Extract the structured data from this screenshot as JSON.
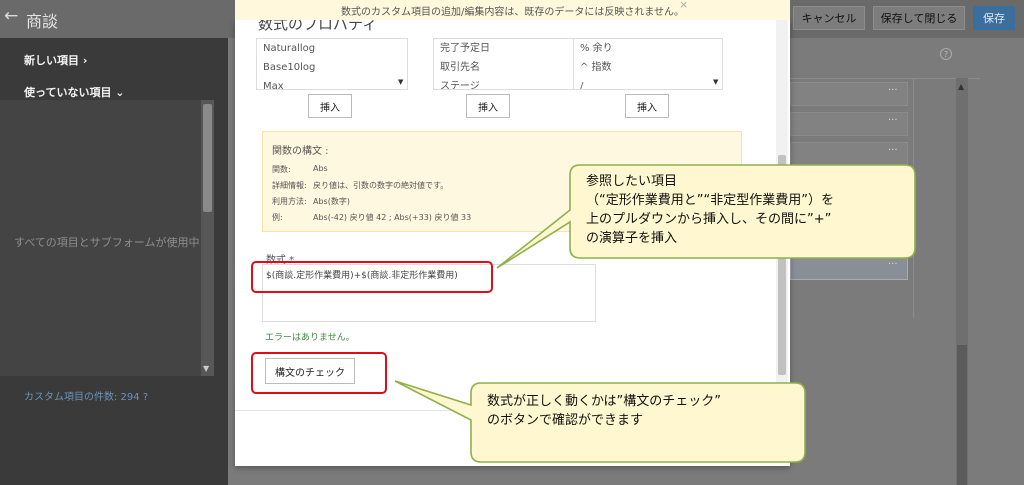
{
  "topbar": {
    "back_glyph": "←",
    "title": "商談",
    "cancel_label": "キャンセル",
    "save_close_label": "保存して閉じる",
    "save_label": "保存"
  },
  "sidebar": {
    "new_items": "新しい項目 ›",
    "unused_items": "使っていない項目 ⌄",
    "all_used": "すべての項目とサブフォームが使用中",
    "custom_count": "カスタム項目の件数: 294 ?"
  },
  "notice": {
    "text": "数式のカスタム項目の追加/編集内容は、既存のデータには反映されません。",
    "close": "×"
  },
  "modal": {
    "title": "数式のプロパティ",
    "functions_list": [
      "Naturallog",
      "Base10log",
      "Max"
    ],
    "fields_list": [
      "完了予定日",
      "取引先名",
      "ステージ"
    ],
    "operators_list": [
      "% 余り",
      "^ 指数",
      "/"
    ],
    "insert_label": "挿入",
    "syntax": {
      "title": "関数の構文 :",
      "rows": [
        {
          "key": "関数:",
          "value": "Abs"
        },
        {
          "key": "詳細情報:",
          "value": "戻り値は、引数の数字の絶対値です。"
        },
        {
          "key": "利用方法:",
          "value": "Abs(数字)"
        },
        {
          "key": "例:",
          "value": "Abs(-42) 戻り値 42 ; Abs(+33) 戻り値 33"
        }
      ]
    },
    "formula_label": "数式 *",
    "formula_value": "$(商談.定形作業費用)+$(商談.非定形作業費用)",
    "no_error": "エラーはありません。",
    "check_syntax_label": "構文のチェック"
  },
  "callouts": {
    "c1": [
      "参照したい項目",
      "（“定形作業費用と”“非定型作業費用”）を",
      "上のプルダウンから挿入し、その間に”+”",
      "の演算子を挿入"
    ],
    "c2": [
      "数式が正しく動くかは”構文のチェック”",
      "のボタンで確認ができます"
    ]
  },
  "colors": {
    "callout_fill": "#fff7cf",
    "callout_stroke": "#8fb04b",
    "highlight": "#e00d18",
    "save_button": "#3a6e9c"
  }
}
